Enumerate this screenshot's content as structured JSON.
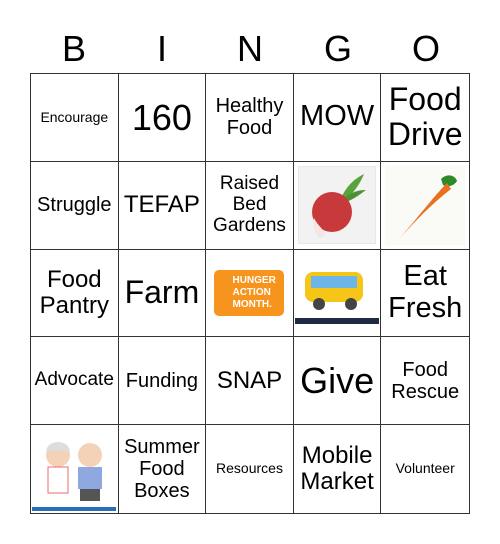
{
  "header": [
    "B",
    "I",
    "N",
    "G",
    "O"
  ],
  "cells": [
    {
      "text": "Encourage",
      "size": "s14"
    },
    {
      "text": "160",
      "size": "s36"
    },
    {
      "text": "Healthy Food",
      "size": "s20"
    },
    {
      "text": "MOW",
      "size": "s28"
    },
    {
      "text": "Food Drive",
      "size": "s32"
    },
    {
      "text": "Struggle",
      "size": "s20"
    },
    {
      "text": "TEFAP",
      "size": "s24"
    },
    {
      "text": "Raised Bed Gardens",
      "size": "s18"
    },
    {
      "image": "radish-image"
    },
    {
      "image": "carrot-image"
    },
    {
      "text": "Food Pantry",
      "size": "s24"
    },
    {
      "text": "Farm",
      "size": "s32"
    },
    {
      "image": "hunger-action-month-logo",
      "logo_lines": [
        "HUNGER",
        "ACTION",
        "MONTH."
      ],
      "logo_color": "#F7941D"
    },
    {
      "image": "school-bus-image"
    },
    {
      "text": "Eat Fresh",
      "size": "s28"
    },
    {
      "text": "Advocate",
      "size": "s18"
    },
    {
      "text": "Funding",
      "size": "s20"
    },
    {
      "text": "SNAP",
      "size": "s24"
    },
    {
      "text": "Give",
      "size": "s36"
    },
    {
      "text": "Food Rescue",
      "size": "s20"
    },
    {
      "image": "grandparents-image"
    },
    {
      "text": "Summer Food Boxes",
      "size": "s20"
    },
    {
      "text": "Resources",
      "size": "s14"
    },
    {
      "text": "Mobile Market",
      "size": "s24"
    },
    {
      "text": "Volunteer",
      "size": "s14"
    }
  ]
}
